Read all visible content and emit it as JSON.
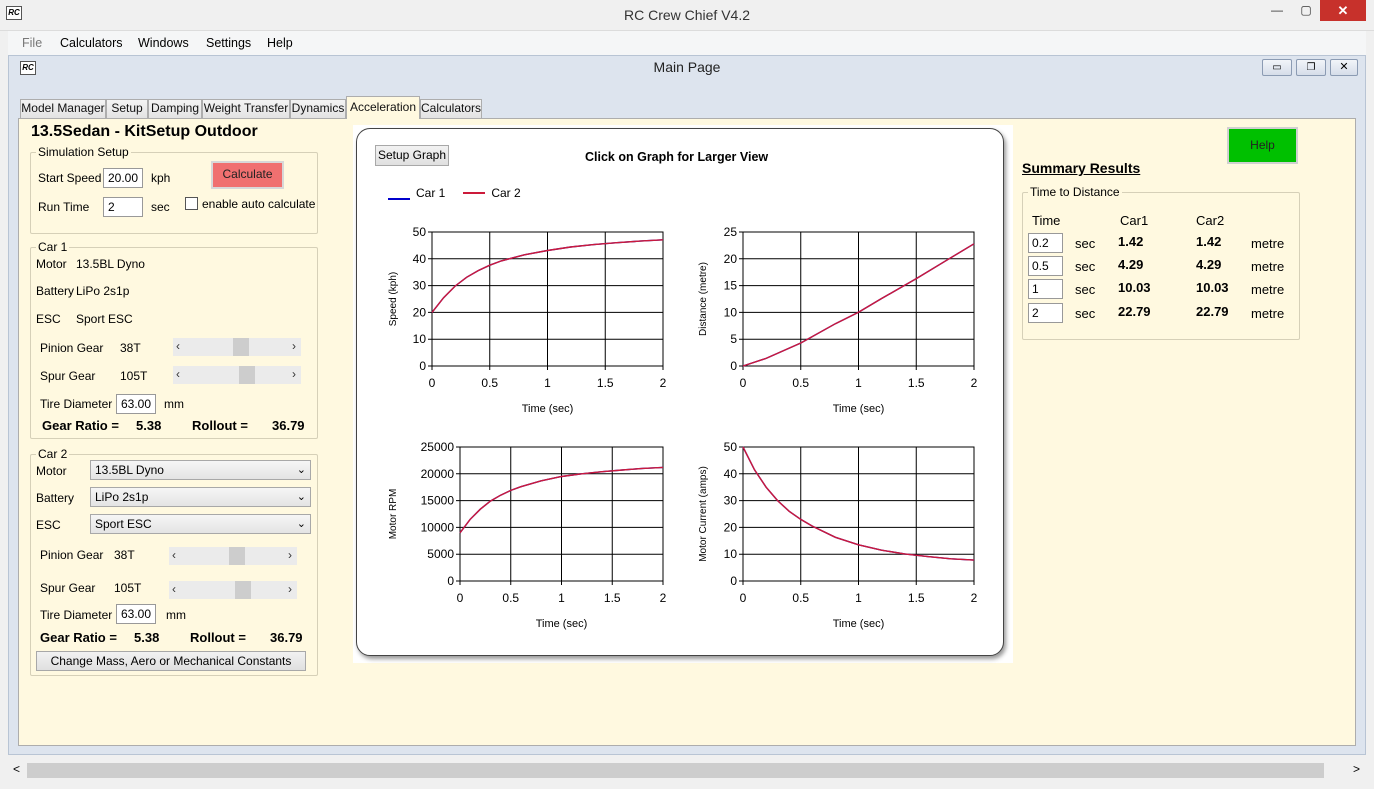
{
  "app": {
    "title": "RC Crew Chief V4.2",
    "logo": "RC",
    "window_controls": {
      "minimize": "—",
      "maximize": "▢",
      "close": "✕"
    }
  },
  "menu": [
    "File",
    "Calculators",
    "Windows",
    "Settings",
    "Help"
  ],
  "child": {
    "title": "Main Page",
    "logo": "RC",
    "controls": {
      "minimize": "▭",
      "restore": "❐",
      "close": "✕"
    }
  },
  "tabs": [
    "Model Manager",
    "Setup",
    "Damping",
    "Weight Transfer",
    "Dynamics",
    "Acceleration",
    "Calculators"
  ],
  "setup_title": "13.5Sedan - KitSetup Outdoor",
  "simulation": {
    "group": "Simulation Setup",
    "start_speed_label": "Start Speed",
    "start_speed": "20.00",
    "speed_unit": "kph",
    "run_time_label": "Run Time",
    "run_time": "2",
    "time_unit": "sec",
    "calculate": "Calculate",
    "auto_calc": "enable auto calculate"
  },
  "car1": {
    "group": "Car 1",
    "motor_label": "Motor",
    "motor": "13.5BL Dyno",
    "battery_label": "Battery",
    "battery": "LiPo 2s1p",
    "esc_label": "ESC",
    "esc": "Sport ESC",
    "pinion_label": "Pinion Gear",
    "pinion": "38T",
    "spur_label": "Spur Gear",
    "spur": "105T",
    "tire_label": "Tire Diameter",
    "tire": "63.00",
    "tire_unit": "mm",
    "gear_ratio_label": "Gear Ratio =",
    "gear_ratio": "5.38",
    "rollout_label": "Rollout =",
    "rollout": "36.79",
    "pinion_slider": 0.55,
    "spur_slider": 0.62
  },
  "car2": {
    "group": "Car 2",
    "motor_label": "Motor",
    "motor": "13.5BL Dyno",
    "battery_label": "Battery",
    "battery": "LiPo 2s1p",
    "esc_label": "ESC",
    "esc": "Sport ESC",
    "pinion_label": "Pinion Gear",
    "pinion": "38T",
    "spur_label": "Spur Gear",
    "spur": "105T",
    "tire_label": "Tire Diameter",
    "tire": "63.00",
    "tire_unit": "mm",
    "gear_ratio_label": "Gear Ratio =",
    "gear_ratio": "5.38",
    "rollout_label": "Rollout =",
    "rollout": "36.79",
    "pinion_slider": 0.55,
    "spur_slider": 0.62,
    "change_button": "Change Mass, Aero or Mechanical Constants"
  },
  "graph": {
    "setup_button": "Setup Graph",
    "heading": "Click on Graph for Larger View",
    "legend": [
      {
        "name": "Car 1",
        "color": "#0000cc"
      },
      {
        "name": "Car 2",
        "color": "#cc1a3a"
      }
    ]
  },
  "chart_data": [
    {
      "type": "line",
      "ylabel": "Speed (kph)",
      "xlabel": "Time (sec)",
      "xlim": [
        0,
        2
      ],
      "ylim": [
        0,
        50
      ],
      "xticks": [
        "0",
        "0.5",
        "1",
        "1.5",
        "2"
      ],
      "yticks": [
        "0",
        "10",
        "20",
        "30",
        "40",
        "50"
      ],
      "x": [
        0,
        0.1,
        0.2,
        0.3,
        0.4,
        0.5,
        0.6,
        0.8,
        1,
        1.2,
        1.4,
        1.6,
        1.8,
        2
      ],
      "series": [
        {
          "name": "Car 1",
          "values": [
            20,
            25.5,
            29.8,
            33.1,
            35.6,
            37.6,
            39.2,
            41.5,
            43.1,
            44.4,
            45.3,
            46.0,
            46.6,
            47.1
          ]
        },
        {
          "name": "Car 2",
          "values": [
            20,
            25.5,
            29.8,
            33.1,
            35.6,
            37.6,
            39.2,
            41.5,
            43.1,
            44.4,
            45.3,
            46.0,
            46.6,
            47.1
          ]
        }
      ]
    },
    {
      "type": "line",
      "ylabel": "Distance (metre)",
      "xlabel": "Time (sec)",
      "xlim": [
        0,
        2
      ],
      "ylim": [
        0,
        25
      ],
      "xticks": [
        "0",
        "0.5",
        "1",
        "1.5",
        "2"
      ],
      "yticks": [
        "0",
        "5",
        "10",
        "15",
        "20",
        "25"
      ],
      "x": [
        0,
        0.2,
        0.5,
        0.8,
        1,
        1.2,
        1.5,
        1.8,
        2
      ],
      "series": [
        {
          "name": "Car 1",
          "values": [
            0,
            1.42,
            4.29,
            7.9,
            10.03,
            12.6,
            16.3,
            20.2,
            22.79
          ]
        },
        {
          "name": "Car 2",
          "values": [
            0,
            1.42,
            4.29,
            7.9,
            10.03,
            12.6,
            16.3,
            20.2,
            22.79
          ]
        }
      ]
    },
    {
      "type": "line",
      "ylabel": "Motor RPM",
      "xlabel": "Time (sec)",
      "xlim": [
        0,
        2
      ],
      "ylim": [
        0,
        25000
      ],
      "xticks": [
        "0",
        "0.5",
        "1",
        "1.5",
        "2"
      ],
      "yticks": [
        "0",
        "5000",
        "10000",
        "15000",
        "20000",
        "25000"
      ],
      "x": [
        0,
        0.1,
        0.2,
        0.3,
        0.4,
        0.5,
        0.6,
        0.8,
        1,
        1.2,
        1.4,
        1.6,
        1.8,
        2
      ],
      "series": [
        {
          "name": "Car 1",
          "values": [
            9000,
            11500,
            13400,
            14900,
            16000,
            16900,
            17600,
            18700,
            19500,
            20000,
            20400,
            20700,
            21000,
            21200
          ]
        },
        {
          "name": "Car 2",
          "values": [
            9000,
            11500,
            13400,
            14900,
            16000,
            16900,
            17600,
            18700,
            19500,
            20000,
            20400,
            20700,
            21000,
            21200
          ]
        }
      ]
    },
    {
      "type": "line",
      "ylabel": "Motor Current (amps)",
      "xlabel": "Time (sec)",
      "xlim": [
        0,
        2
      ],
      "ylim": [
        0,
        50
      ],
      "xticks": [
        "0",
        "0.5",
        "1",
        "1.5",
        "2"
      ],
      "yticks": [
        "0",
        "10",
        "20",
        "30",
        "40",
        "50"
      ],
      "x": [
        0,
        0.1,
        0.2,
        0.3,
        0.4,
        0.5,
        0.6,
        0.8,
        1,
        1.2,
        1.4,
        1.6,
        1.8,
        2
      ],
      "series": [
        {
          "name": "Car 1",
          "values": [
            50,
            41.5,
            35,
            30,
            26,
            23,
            20.5,
            16.3,
            13.5,
            11.5,
            10.1,
            9.1,
            8.3,
            7.8
          ]
        },
        {
          "name": "Car 2",
          "values": [
            50,
            41.5,
            35,
            30,
            26,
            23,
            20.5,
            16.3,
            13.5,
            11.5,
            10.1,
            9.1,
            8.3,
            7.8
          ]
        }
      ]
    }
  ],
  "summary": {
    "title": "Summary Results",
    "group": "Time to Distance",
    "help": "Help",
    "help_color": "#00c000",
    "headers": {
      "time": "Time",
      "car1": "Car1",
      "car2": "Car2"
    },
    "rows": [
      {
        "time": "0.2",
        "unit": "sec",
        "car1": "1.42",
        "car2": "1.42",
        "dist_unit": "metre"
      },
      {
        "time": "0.5",
        "unit": "sec",
        "car1": "4.29",
        "car2": "4.29",
        "dist_unit": "metre"
      },
      {
        "time": "1",
        "unit": "sec",
        "car1": "10.03",
        "car2": "10.03",
        "dist_unit": "metre"
      },
      {
        "time": "2",
        "unit": "sec",
        "car1": "22.79",
        "car2": "22.79",
        "dist_unit": "metre"
      }
    ]
  },
  "scrollbar": {
    "left": "<",
    "right": ">"
  },
  "colors": {
    "panel_bg": "#fff9e0",
    "calculate_btn": "#f07070",
    "car1": "#0000cc",
    "car2": "#cc1a3a"
  }
}
